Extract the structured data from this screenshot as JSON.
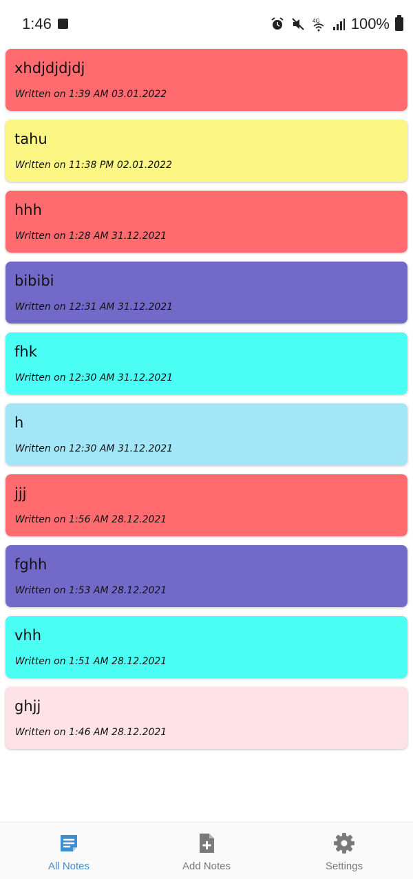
{
  "status_bar": {
    "time": "1:46",
    "battery": "100%",
    "network": "4G"
  },
  "notes": [
    {
      "title": "xhdjdjdjdj",
      "date": "Written on 1:39 AM 03.01.2022",
      "color": "#ff6b6f"
    },
    {
      "title": "tahu",
      "date": "Written on 11:38 PM 02.01.2022",
      "color": "#fcf785"
    },
    {
      "title": "hhh",
      "date": "Written on 1:28 AM 31.12.2021",
      "color": "#ff6b6f"
    },
    {
      "title": "bibibi",
      "date": "Written on 12:31 AM 31.12.2021",
      "color": "#7369c9"
    },
    {
      "title": "fhk",
      "date": "Written on 12:30 AM 31.12.2021",
      "color": "#4cfff4"
    },
    {
      "title": "h",
      "date": "Written on 12:30 AM 31.12.2021",
      "color": "#a2e6f7"
    },
    {
      "title": "jjj",
      "date": "Written on 1:56 AM 28.12.2021",
      "color": "#ff6b6f"
    },
    {
      "title": "fghh",
      "date": "Written on 1:53 AM 28.12.2021",
      "color": "#7369c9"
    },
    {
      "title": "vhh",
      "date": "Written on 1:51 AM 28.12.2021",
      "color": "#4cfff4"
    },
    {
      "title": "ghjj",
      "date": "Written on 1:46 AM 28.12.2021",
      "color": "#fde3e7"
    }
  ],
  "bottom_nav": {
    "items": [
      {
        "label": "All Notes",
        "icon": "notes-icon",
        "active": true
      },
      {
        "label": "Add Notes",
        "icon": "add-note-icon",
        "active": false
      },
      {
        "label": "Settings",
        "icon": "gear-icon",
        "active": false
      }
    ],
    "active_color": "#3d8fd0",
    "inactive_color": "#7a7a7a"
  }
}
